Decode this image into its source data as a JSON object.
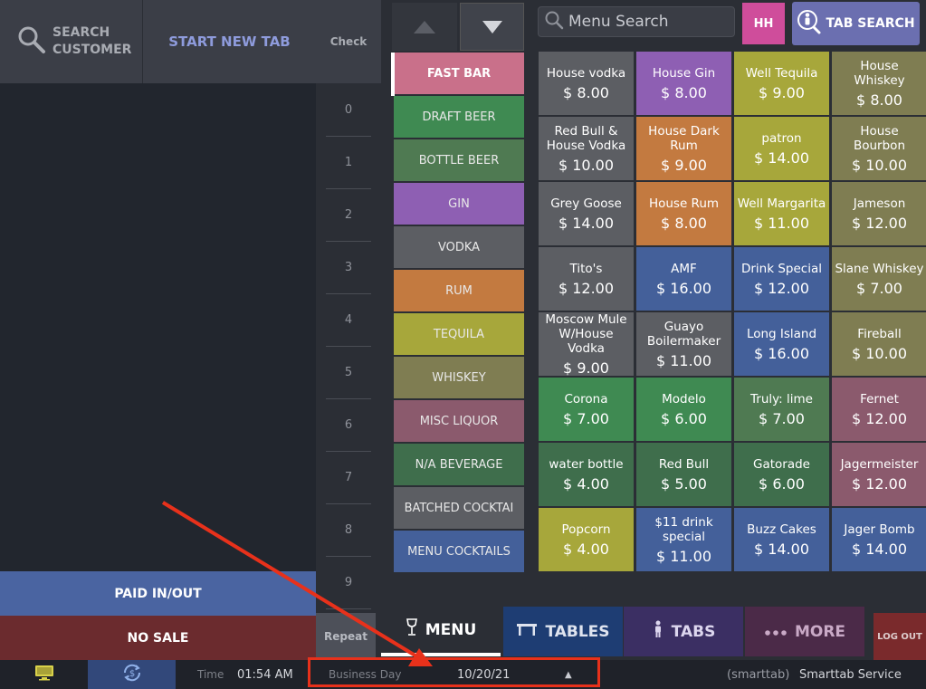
{
  "header": {
    "search_customer": "SEARCH\nCUSTOMER",
    "start_new_tab": "START NEW TAB",
    "check": "Check",
    "menu_search_placeholder": "Menu Search",
    "hh": "HH",
    "tab_search": "TAB SEARCH"
  },
  "seats": [
    "0",
    "1",
    "2",
    "3",
    "4",
    "5",
    "6",
    "7",
    "8",
    "9"
  ],
  "left_actions": {
    "paid_inout": "PAID IN/OUT",
    "no_sale": "NO SALE",
    "repeat": "Repeat"
  },
  "categories": [
    {
      "label": "FAST BAR",
      "color": "#c9708a",
      "active": true
    },
    {
      "label": "DRAFT BEER",
      "color": "#3f8a52"
    },
    {
      "label": "BOTTLE BEER",
      "color": "#4f7a52"
    },
    {
      "label": "GIN",
      "color": "#8e5fb3"
    },
    {
      "label": "VODKA",
      "color": "#5c5e63"
    },
    {
      "label": "RUM",
      "color": "#c37a40"
    },
    {
      "label": "TEQUILA",
      "color": "#a7a73b"
    },
    {
      "label": "WHISKEY",
      "color": "#7f7d52"
    },
    {
      "label": "MISC LIQUOR",
      "color": "#8b5a6d"
    },
    {
      "label": "N/A BEVERAGE",
      "color": "#3f6e4c"
    },
    {
      "label": "BATCHED COCKTAI",
      "color": "#5c5e63"
    },
    {
      "label": "MENU COCKTAILS",
      "color": "#44609a"
    }
  ],
  "items": [
    {
      "name": "House vodka",
      "price": "$ 8.00",
      "color": "#5c5e63"
    },
    {
      "name": "House Gin",
      "price": "$ 8.00",
      "color": "#8e5fb3"
    },
    {
      "name": "Well Tequila",
      "price": "$ 9.00",
      "color": "#a7a73b"
    },
    {
      "name": "House Whiskey",
      "price": "$ 8.00",
      "color": "#7f7d52"
    },
    {
      "name": "Red Bull & House Vodka",
      "price": "$ 10.00",
      "color": "#5c5e63"
    },
    {
      "name": "House Dark Rum",
      "price": "$ 9.00",
      "color": "#c37a40"
    },
    {
      "name": "patron",
      "price": "$ 14.00",
      "color": "#a7a73b"
    },
    {
      "name": "House Bourbon",
      "price": "$ 10.00",
      "color": "#7f7d52"
    },
    {
      "name": "Grey Goose",
      "price": "$ 14.00",
      "color": "#5c5e63"
    },
    {
      "name": "House Rum",
      "price": "$ 8.00",
      "color": "#c37a40"
    },
    {
      "name": "Well Margarita",
      "price": "$ 11.00",
      "color": "#a7a73b"
    },
    {
      "name": "Jameson",
      "price": "$ 12.00",
      "color": "#7f7d52"
    },
    {
      "name": "Tito's",
      "price": "$ 12.00",
      "color": "#5c5e63"
    },
    {
      "name": "AMF",
      "price": "$ 16.00",
      "color": "#44609a"
    },
    {
      "name": "Drink Special",
      "price": "$ 12.00",
      "color": "#44609a"
    },
    {
      "name": "Slane Whiskey",
      "price": "$ 7.00",
      "color": "#7f7d52"
    },
    {
      "name": "Moscow Mule W/House Vodka",
      "price": "$ 9.00",
      "color": "#5c5e63"
    },
    {
      "name": "Guayo Boilermaker",
      "price": "$ 11.00",
      "color": "#5c5e63"
    },
    {
      "name": "Long Island",
      "price": "$ 16.00",
      "color": "#44609a"
    },
    {
      "name": "Fireball",
      "price": "$ 10.00",
      "color": "#7f7d52"
    },
    {
      "name": "Corona",
      "price": "$ 7.00",
      "color": "#3f8a52"
    },
    {
      "name": "Modelo",
      "price": "$ 6.00",
      "color": "#3f8a52"
    },
    {
      "name": "Truly: lime",
      "price": "$ 7.00",
      "color": "#4f7a52"
    },
    {
      "name": "Fernet",
      "price": "$ 12.00",
      "color": "#8b5a6d"
    },
    {
      "name": "water bottle",
      "price": "$ 4.00",
      "color": "#3f6e4c"
    },
    {
      "name": "Red Bull",
      "price": "$ 5.00",
      "color": "#3f6e4c"
    },
    {
      "name": "Gatorade",
      "price": "$ 6.00",
      "color": "#3f6e4c"
    },
    {
      "name": "Jagermeister",
      "price": "$ 12.00",
      "color": "#8b5a6d"
    },
    {
      "name": "Popcorn",
      "price": "$ 4.00",
      "color": "#a7a73b"
    },
    {
      "name": "$11 drink special",
      "price": "$ 11.00",
      "color": "#44609a"
    },
    {
      "name": "Buzz Cakes",
      "price": "$ 14.00",
      "color": "#44609a"
    },
    {
      "name": "Jager Bomb",
      "price": "$ 14.00",
      "color": "#44609a"
    }
  ],
  "nav": {
    "menu": "MENU",
    "tables": "TABLES",
    "tabs": "TABS",
    "more": "MORE",
    "logout": "LOG OUT"
  },
  "status": {
    "time_label": "Time",
    "time_value": "01:54 AM",
    "business_day_label": "Business Day",
    "business_day_value": "10/20/21",
    "brand": "(smarttab)",
    "service": "Smarttab Service"
  }
}
